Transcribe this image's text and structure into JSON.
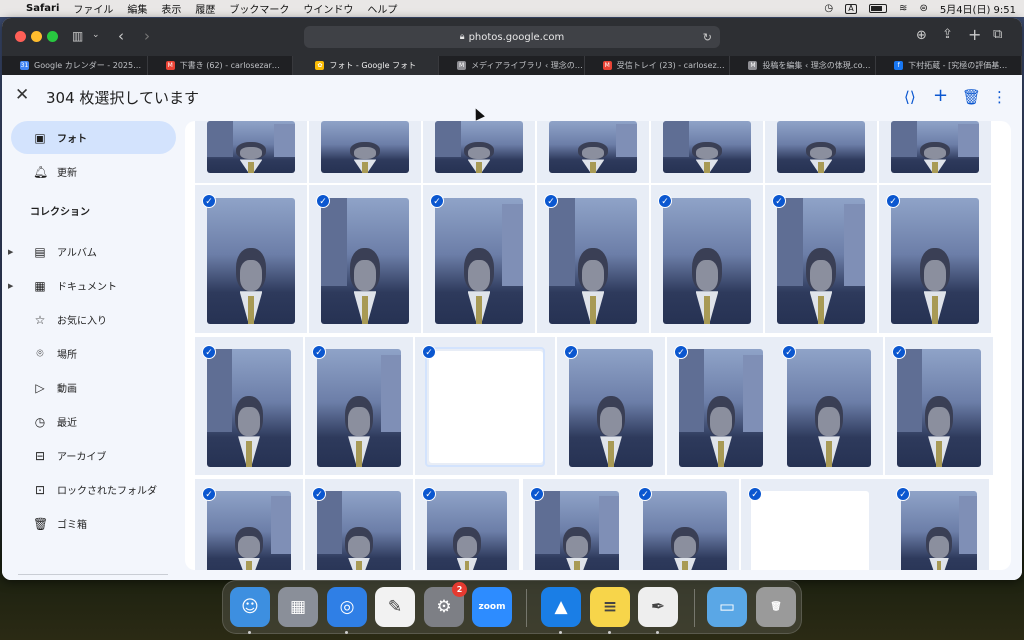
{
  "menubar": {
    "apple": "",
    "app": "Safari",
    "items": [
      "ファイル",
      "編集",
      "表示",
      "履歴",
      "ブックマーク",
      "ウインドウ",
      "ヘルプ"
    ],
    "input_source": "A",
    "datetime": "5月4日(日)  9:51"
  },
  "browser": {
    "url": "photos.google.com",
    "tabs": [
      {
        "title": "Google カレンダー - 2025…",
        "favicon_color": "#4285f4",
        "glyph": "31"
      },
      {
        "title": "下書き (62) - carlosezar…",
        "favicon_color": "#ea4335",
        "glyph": "M"
      },
      {
        "title": "フォト - Google フォト",
        "favicon_color": "#fbbc04",
        "glyph": "✿"
      },
      {
        "title": "メディアライブラリ ‹ 理念の…",
        "favicon_color": "#8e8e93",
        "glyph": "M"
      },
      {
        "title": "受信トレイ (23) - carlosez…",
        "favicon_color": "#ea4335",
        "glyph": "M"
      },
      {
        "title": "投稿を編集 ‹ 理念の体現.co…",
        "favicon_color": "#8e8e93",
        "glyph": "M"
      },
      {
        "title": "下村拓蔵 - [究極の評価基…",
        "favicon_color": "#1877f2",
        "glyph": "f"
      }
    ]
  },
  "header": {
    "close": "✕",
    "selection_title": "304 枚選択しています",
    "icons": {
      "share": "share-icon",
      "add": "add-icon",
      "delete": "trash-icon",
      "more": "more-icon"
    }
  },
  "sidebar": {
    "items": [
      {
        "label": "フォト",
        "icon": "▣",
        "active": true
      },
      {
        "label": "更新",
        "icon": "🔔︎"
      }
    ],
    "collection_heading": "コレクション",
    "collections": [
      {
        "label": "アルバム",
        "icon": "▤",
        "expandable": true
      },
      {
        "label": "ドキュメント",
        "icon": "▦",
        "expandable": true
      },
      {
        "label": "お気に入り",
        "icon": "☆"
      },
      {
        "label": "場所",
        "icon": "⌾"
      },
      {
        "label": "動画",
        "icon": "▷"
      },
      {
        "label": "最近",
        "icon": "◷"
      },
      {
        "label": "アーカイブ",
        "icon": "⊟"
      },
      {
        "label": "ロックされたフォルダ",
        "icon": "⊡"
      },
      {
        "label": "ゴミ箱",
        "icon": "🗑︎"
      }
    ]
  },
  "grid": {
    "selected_check": "✓",
    "sparkle": "✦"
  },
  "dock": {
    "apps": [
      {
        "name": "Finder",
        "color": "#3d8fe0",
        "glyph": "☺"
      },
      {
        "name": "Launchpad",
        "color": "#8a8f99",
        "glyph": "▦"
      },
      {
        "name": "Safari",
        "color": "#2f7fe6",
        "glyph": "◎"
      },
      {
        "name": "Freeform",
        "color": "#f2f2f2",
        "glyph": "✎"
      },
      {
        "name": "System Settings",
        "color": "#7d7f85",
        "glyph": "⚙",
        "badge": "2"
      },
      {
        "name": "Zoom",
        "color": "#2d8cff",
        "glyph": "zoom"
      },
      {
        "name": "Keynote",
        "color": "#1a7ee6",
        "glyph": "▲"
      },
      {
        "name": "Notes",
        "color": "#f7d54a",
        "glyph": "≡"
      },
      {
        "name": "TextEdit",
        "color": "#eeeeee",
        "glyph": "✒"
      },
      {
        "name": "Downloads",
        "color": "#5aa7e6",
        "glyph": "▭"
      },
      {
        "name": "Trash",
        "color": "#9a9a9a",
        "glyph": "🗑︎"
      }
    ]
  }
}
